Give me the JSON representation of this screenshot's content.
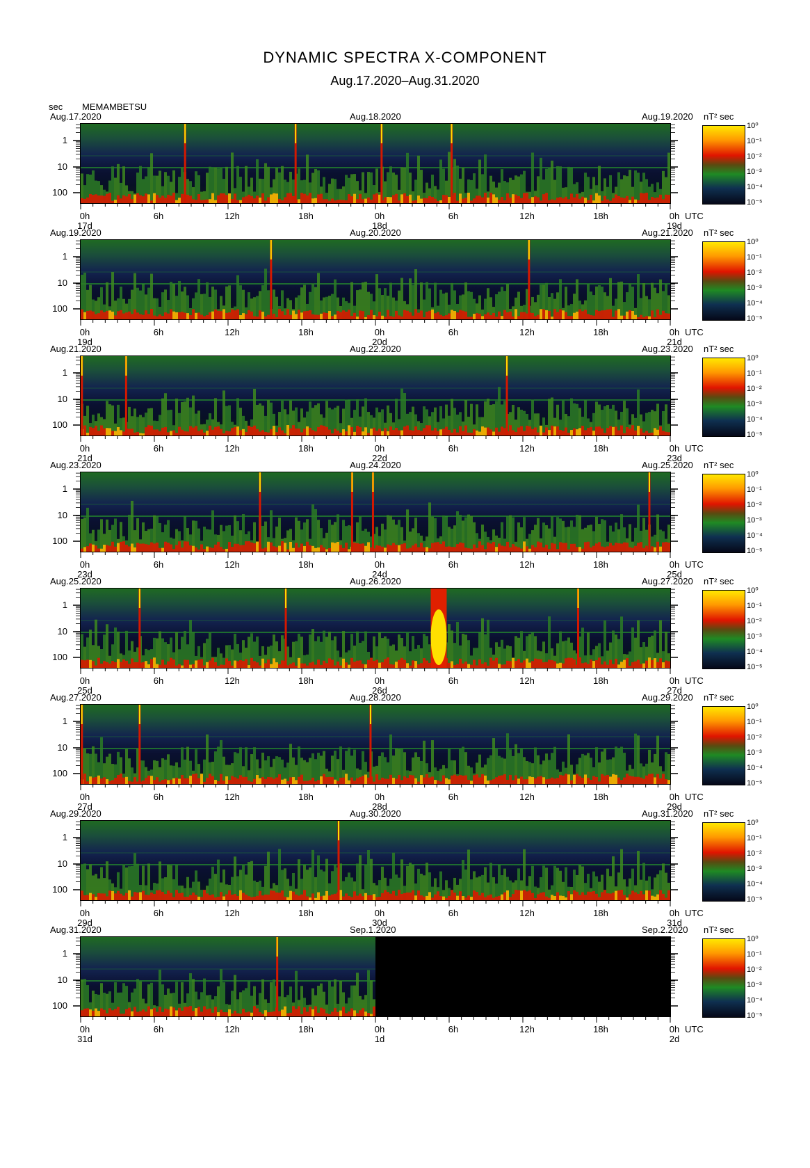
{
  "title": "DYNAMIC SPECTRA X-COMPONENT",
  "subtitle": "Aug.17.2020–Aug.31.2020",
  "y_unit": "sec",
  "station": "MEMAMBETSU",
  "x_unit": "UTC",
  "colorbar_unit": "nT² sec",
  "colorbar_labels": [
    "10⁰",
    "10⁻¹",
    "10⁻²",
    "10⁻³",
    "10⁻⁴",
    "10⁻⁵"
  ],
  "y_tick_labels": [
    "1",
    "10",
    "100"
  ],
  "x_tick_labels": [
    "0h",
    "6h",
    "12h",
    "18h",
    "0h",
    "6h",
    "12h",
    "18h",
    "0h"
  ],
  "colors": {
    "yellow": "#ffe000",
    "red": "#e01000",
    "green": "#208020",
    "navy": "#101540",
    "black": "#000000"
  },
  "chart_data": {
    "type": "heatmap",
    "title": "DYNAMIC SPECTRA X-COMPONENT",
    "subtitle": "Aug.17.2020–Aug.31.2020",
    "ylabel": "sec",
    "xlabel": "UTC",
    "y_scale": "log",
    "y_ticks": [
      1,
      10,
      100
    ],
    "colorbar": {
      "label": "nT² sec",
      "range": [
        "10⁻⁵",
        "10⁰"
      ],
      "scale": "log"
    },
    "panels": [
      {
        "start": "Aug.17.2020",
        "mid": "Aug.18.2020",
        "end": "Aug.19.2020",
        "day_labels": [
          "17d",
          "18d",
          "19d"
        ],
        "data_until_hours": 48,
        "spikes_hours": [
          8.5,
          17.5,
          24.5,
          30.2
        ]
      },
      {
        "start": "Aug.19.2020",
        "mid": "Aug.20.2020",
        "end": "Aug.21.2020",
        "day_labels": [
          "19d",
          "20d",
          "21d"
        ],
        "data_until_hours": 48,
        "spikes_hours": [
          15.5,
          36.5
        ]
      },
      {
        "start": "Aug.21.2020",
        "mid": "Aug.22.2020",
        "end": "Aug.23.2020",
        "day_labels": [
          "21d",
          "22d",
          "23d"
        ],
        "data_until_hours": 48,
        "spikes_hours": [
          0.1,
          3.7,
          34.7
        ]
      },
      {
        "start": "Aug.23.2020",
        "mid": "Aug.24.2020",
        "end": "Aug.25.2020",
        "day_labels": [
          "23d",
          "24d",
          "25d"
        ],
        "data_until_hours": 48,
        "spikes_hours": [
          14.6,
          22.1,
          23.8,
          46.3
        ]
      },
      {
        "start": "Aug.25.2020",
        "mid": "Aug.26.2020",
        "end": "Aug.27.2020",
        "day_labels": [
          "25d",
          "26d",
          "27d"
        ],
        "data_until_hours": 48,
        "spikes_hours": [
          4.8,
          16.7,
          40.5
        ],
        "storm_hours": [
          28.5,
          29.8
        ]
      },
      {
        "start": "Aug.27.2020",
        "mid": "Aug.28.2020",
        "end": "Aug.29.2020",
        "day_labels": [
          "27d",
          "28d",
          "29d"
        ],
        "data_until_hours": 48,
        "spikes_hours": [
          0.1,
          4.8,
          23.6
        ]
      },
      {
        "start": "Aug.29.2020",
        "mid": "Aug.30.2020",
        "end": "Aug.31.2020",
        "day_labels": [
          "29d",
          "30d",
          "31d"
        ],
        "data_until_hours": 48,
        "spikes_hours": [
          21.0
        ]
      },
      {
        "start": "Aug.31.2020",
        "mid": "Sep.1.2020",
        "end": "Sep.2.2020",
        "day_labels": [
          "31d",
          "1d",
          "2d"
        ],
        "data_until_hours": 24,
        "spikes_hours": [
          16.0
        ]
      }
    ]
  }
}
